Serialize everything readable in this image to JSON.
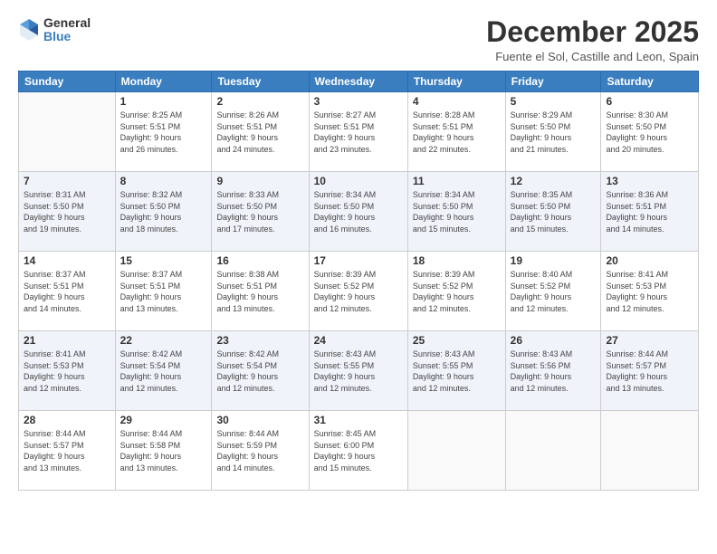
{
  "logo": {
    "general": "General",
    "blue": "Blue"
  },
  "title": "December 2025",
  "location": "Fuente el Sol, Castille and Leon, Spain",
  "days_header": [
    "Sunday",
    "Monday",
    "Tuesday",
    "Wednesday",
    "Thursday",
    "Friday",
    "Saturday"
  ],
  "weeks": [
    [
      {
        "num": "",
        "info": ""
      },
      {
        "num": "1",
        "info": "Sunrise: 8:25 AM\nSunset: 5:51 PM\nDaylight: 9 hours\nand 26 minutes."
      },
      {
        "num": "2",
        "info": "Sunrise: 8:26 AM\nSunset: 5:51 PM\nDaylight: 9 hours\nand 24 minutes."
      },
      {
        "num": "3",
        "info": "Sunrise: 8:27 AM\nSunset: 5:51 PM\nDaylight: 9 hours\nand 23 minutes."
      },
      {
        "num": "4",
        "info": "Sunrise: 8:28 AM\nSunset: 5:51 PM\nDaylight: 9 hours\nand 22 minutes."
      },
      {
        "num": "5",
        "info": "Sunrise: 8:29 AM\nSunset: 5:50 PM\nDaylight: 9 hours\nand 21 minutes."
      },
      {
        "num": "6",
        "info": "Sunrise: 8:30 AM\nSunset: 5:50 PM\nDaylight: 9 hours\nand 20 minutes."
      }
    ],
    [
      {
        "num": "7",
        "info": "Sunrise: 8:31 AM\nSunset: 5:50 PM\nDaylight: 9 hours\nand 19 minutes."
      },
      {
        "num": "8",
        "info": "Sunrise: 8:32 AM\nSunset: 5:50 PM\nDaylight: 9 hours\nand 18 minutes."
      },
      {
        "num": "9",
        "info": "Sunrise: 8:33 AM\nSunset: 5:50 PM\nDaylight: 9 hours\nand 17 minutes."
      },
      {
        "num": "10",
        "info": "Sunrise: 8:34 AM\nSunset: 5:50 PM\nDaylight: 9 hours\nand 16 minutes."
      },
      {
        "num": "11",
        "info": "Sunrise: 8:34 AM\nSunset: 5:50 PM\nDaylight: 9 hours\nand 15 minutes."
      },
      {
        "num": "12",
        "info": "Sunrise: 8:35 AM\nSunset: 5:50 PM\nDaylight: 9 hours\nand 15 minutes."
      },
      {
        "num": "13",
        "info": "Sunrise: 8:36 AM\nSunset: 5:51 PM\nDaylight: 9 hours\nand 14 minutes."
      }
    ],
    [
      {
        "num": "14",
        "info": "Sunrise: 8:37 AM\nSunset: 5:51 PM\nDaylight: 9 hours\nand 14 minutes."
      },
      {
        "num": "15",
        "info": "Sunrise: 8:37 AM\nSunset: 5:51 PM\nDaylight: 9 hours\nand 13 minutes."
      },
      {
        "num": "16",
        "info": "Sunrise: 8:38 AM\nSunset: 5:51 PM\nDaylight: 9 hours\nand 13 minutes."
      },
      {
        "num": "17",
        "info": "Sunrise: 8:39 AM\nSunset: 5:52 PM\nDaylight: 9 hours\nand 12 minutes."
      },
      {
        "num": "18",
        "info": "Sunrise: 8:39 AM\nSunset: 5:52 PM\nDaylight: 9 hours\nand 12 minutes."
      },
      {
        "num": "19",
        "info": "Sunrise: 8:40 AM\nSunset: 5:52 PM\nDaylight: 9 hours\nand 12 minutes."
      },
      {
        "num": "20",
        "info": "Sunrise: 8:41 AM\nSunset: 5:53 PM\nDaylight: 9 hours\nand 12 minutes."
      }
    ],
    [
      {
        "num": "21",
        "info": "Sunrise: 8:41 AM\nSunset: 5:53 PM\nDaylight: 9 hours\nand 12 minutes."
      },
      {
        "num": "22",
        "info": "Sunrise: 8:42 AM\nSunset: 5:54 PM\nDaylight: 9 hours\nand 12 minutes."
      },
      {
        "num": "23",
        "info": "Sunrise: 8:42 AM\nSunset: 5:54 PM\nDaylight: 9 hours\nand 12 minutes."
      },
      {
        "num": "24",
        "info": "Sunrise: 8:43 AM\nSunset: 5:55 PM\nDaylight: 9 hours\nand 12 minutes."
      },
      {
        "num": "25",
        "info": "Sunrise: 8:43 AM\nSunset: 5:55 PM\nDaylight: 9 hours\nand 12 minutes."
      },
      {
        "num": "26",
        "info": "Sunrise: 8:43 AM\nSunset: 5:56 PM\nDaylight: 9 hours\nand 12 minutes."
      },
      {
        "num": "27",
        "info": "Sunrise: 8:44 AM\nSunset: 5:57 PM\nDaylight: 9 hours\nand 13 minutes."
      }
    ],
    [
      {
        "num": "28",
        "info": "Sunrise: 8:44 AM\nSunset: 5:57 PM\nDaylight: 9 hours\nand 13 minutes."
      },
      {
        "num": "29",
        "info": "Sunrise: 8:44 AM\nSunset: 5:58 PM\nDaylight: 9 hours\nand 13 minutes."
      },
      {
        "num": "30",
        "info": "Sunrise: 8:44 AM\nSunset: 5:59 PM\nDaylight: 9 hours\nand 14 minutes."
      },
      {
        "num": "31",
        "info": "Sunrise: 8:45 AM\nSunset: 6:00 PM\nDaylight: 9 hours\nand 15 minutes."
      },
      {
        "num": "",
        "info": ""
      },
      {
        "num": "",
        "info": ""
      },
      {
        "num": "",
        "info": ""
      }
    ]
  ]
}
